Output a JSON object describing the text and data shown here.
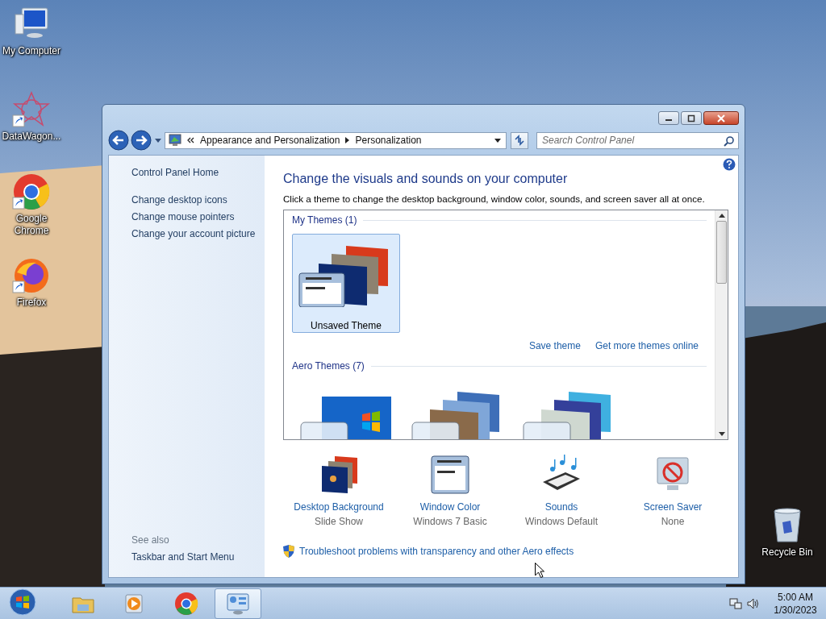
{
  "desktop_icons": [
    {
      "kind": "computer",
      "label": "My Computer",
      "shortcut": false
    },
    {
      "kind": "star",
      "label": "DataWagon...",
      "shortcut": true
    },
    {
      "kind": "chrome",
      "label": "Google Chrome",
      "shortcut": true
    },
    {
      "kind": "firefox",
      "label": "Firefox",
      "shortcut": true
    }
  ],
  "recycle_bin": {
    "label": "Recycle Bin"
  },
  "window": {
    "address": {
      "segments": [
        "Appearance and Personalization",
        "Personalization"
      ]
    },
    "search": {
      "placeholder": "Search Control Panel"
    },
    "sidebar": {
      "items": [
        "Control Panel Home",
        "Change desktop icons",
        "Change mouse pointers",
        "Change your account picture"
      ],
      "see_also_label": "See also",
      "see_also": [
        "Taskbar and Start Menu"
      ]
    },
    "heading": "Change the visuals and sounds on your computer",
    "description": "Click a theme to change the desktop background, window color, sounds, and screen saver all at once.",
    "theme_groups": [
      {
        "title": "My Themes (1)",
        "themes": [
          {
            "kind": "slideshow",
            "label": "Unsaved Theme",
            "selected": true
          }
        ],
        "links": [
          "Save theme",
          "Get more themes online"
        ]
      },
      {
        "title": "Aero Themes (7)",
        "themes": [
          {
            "kind": "windows",
            "selected": false
          },
          {
            "kind": "architecture",
            "selected": false
          },
          {
            "kind": "characters",
            "selected": false
          }
        ]
      }
    ],
    "settings": [
      {
        "kind": "background",
        "title": "Desktop Background",
        "value": "Slide Show"
      },
      {
        "kind": "color",
        "title": "Window Color",
        "value": "Windows 7 Basic"
      },
      {
        "kind": "sounds",
        "title": "Sounds",
        "value": "Windows Default"
      },
      {
        "kind": "screensaver",
        "title": "Screen Saver",
        "value": "None"
      }
    ],
    "troubleshoot": "Troubleshoot problems with transparency and other Aero effects"
  },
  "taskbar": {
    "apps": [
      {
        "kind": "explorer",
        "active": false
      },
      {
        "kind": "media",
        "active": false
      },
      {
        "kind": "chrome",
        "active": false
      },
      {
        "kind": "control_panel",
        "active": true
      }
    ],
    "clock": {
      "time": "5:00 AM",
      "date": "1/30/2023"
    }
  }
}
